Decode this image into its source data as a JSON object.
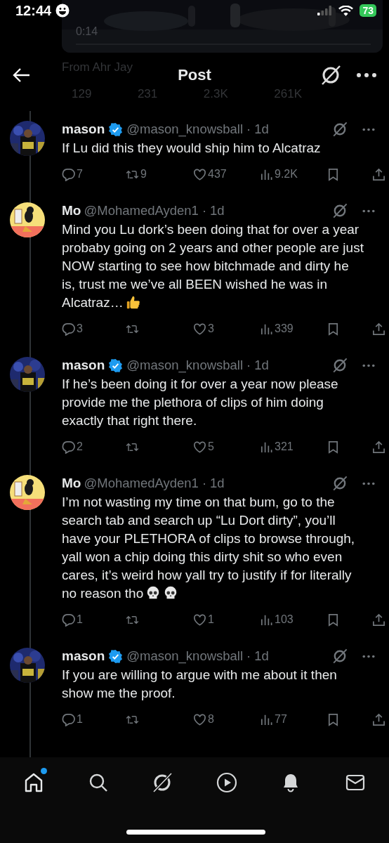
{
  "status_bar": {
    "time": "12:44",
    "battery": "73"
  },
  "background_post": {
    "video_time": "0:14",
    "source": "From Ahr Jay",
    "stats": [
      "129",
      "231",
      "2.3K",
      "261K"
    ]
  },
  "header": {
    "title": "Post"
  },
  "replies": [
    {
      "name": "mason",
      "verified": true,
      "handle": "@mason_knowsball",
      "dot": "·",
      "time": "1d",
      "avatar": {
        "kind": "crowd"
      },
      "text": "If Lu did this they would ship him to Alcatraz",
      "replies": "7",
      "reposts": "9",
      "likes": "437",
      "views": "9.2K"
    },
    {
      "name": "Mo",
      "verified": false,
      "handle": "@MohamedAyden1",
      "dot": "·",
      "time": "1d",
      "avatar": {
        "kind": "cartoon"
      },
      "text": "Mind you Lu dork’s been doing that for over a year probaby going on 2 years and other people are just NOW starting to see how bitchmade and dirty he is, trust me we’ve all BEEN wished he was in Alcatraz…",
      "emoji": [
        {
          "kind": "thumbs-up"
        }
      ],
      "replies": "3",
      "likes": "3",
      "views": "339"
    },
    {
      "name": "mason",
      "verified": true,
      "handle": "@mason_knowsball",
      "dot": "·",
      "time": "1d",
      "avatar": {
        "kind": "crowd"
      },
      "text": "If he’s been doing it for over a year now please provide me the plethora of clips of him doing exactly that right there.",
      "replies": "2",
      "likes": "5",
      "views": "321"
    },
    {
      "name": "Mo",
      "verified": false,
      "handle": "@MohamedAyden1",
      "dot": "·",
      "time": "1d",
      "avatar": {
        "kind": "cartoon"
      },
      "text": "I’m not wasting my time on that bum, go to the search tab and search up “Lu Dort dirty”, you’ll have your PLETHORA of clips to browse through, yall won a chip doing this dirty shit so who even cares, it’s weird how yall try to justify if for literally no reason tho",
      "emoji": [
        {
          "kind": "skull"
        },
        {
          "kind": "skull"
        }
      ],
      "replies": "1",
      "likes": "1",
      "views": "103"
    },
    {
      "name": "mason",
      "verified": true,
      "handle": "@mason_knowsball",
      "dot": "·",
      "time": "1d",
      "avatar": {
        "kind": "crowd"
      },
      "text": "If you are willing to argue with me about it then show me the proof.",
      "replies": "1",
      "likes": "8",
      "views": "77"
    }
  ],
  "nav": [
    {
      "kind": "home",
      "selected": true,
      "badge": true
    },
    {
      "kind": "search",
      "selected": false,
      "badge": false
    },
    {
      "kind": "slash",
      "selected": false,
      "badge": false
    },
    {
      "kind": "play",
      "selected": false,
      "badge": false
    },
    {
      "kind": "bell",
      "selected": false,
      "badge": false
    },
    {
      "kind": "mail",
      "selected": false,
      "badge": false
    }
  ]
}
